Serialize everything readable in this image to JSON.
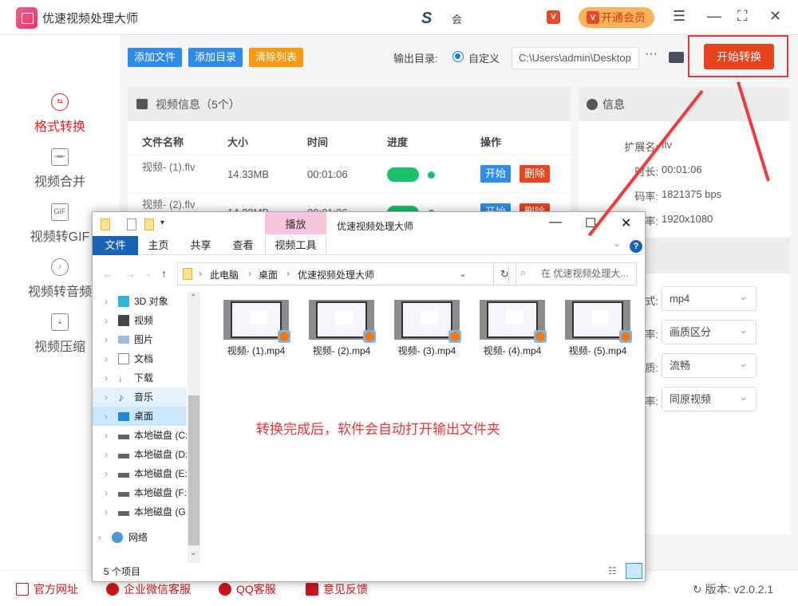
{
  "titlebar": {
    "app_title": "优速视频处理大师",
    "brand_text": "会",
    "vip_badge": "VIP",
    "member_button": "开通会员",
    "menu_icon": "☰",
    "minimize_icon": "—",
    "maximize_icon": "⛶",
    "close_icon": "✕"
  },
  "sidebar": {
    "items": [
      {
        "label": "格式转换",
        "icon": "⇆",
        "active": true
      },
      {
        "label": "视频合并",
        "icon": "⇥⇤"
      },
      {
        "label": "视频转GIF",
        "icon": "GIF"
      },
      {
        "label": "视频转音频",
        "icon": "♪"
      },
      {
        "label": "视频压缩",
        "icon": "⇣"
      }
    ]
  },
  "toolbar": {
    "add_file": "添加文件",
    "add_dir": "添加目录",
    "clear_list": "清除列表",
    "output_label": "输出目录:",
    "custom_option": "自定义",
    "output_path": "C:\\Users\\admin\\Desktop",
    "more": "···",
    "start_convert": "开始转换"
  },
  "video_panel": {
    "title": "视频信息（5个）",
    "columns": [
      "文件名称",
      "大小",
      "时间",
      "进度",
      "操作"
    ],
    "rows": [
      {
        "name": "视频- (1).flv",
        "size": "14.33MB",
        "time": "00:01:06",
        "progress": 100,
        "start": "开始",
        "delete": "删除"
      },
      {
        "name": "视频- (2).flv",
        "size": "14.33MB",
        "time": "00:01:06",
        "progress": 100,
        "start": "开始",
        "delete": "删除"
      }
    ]
  },
  "info_panel": {
    "title": "信息",
    "rows": [
      {
        "key": "扩展名:",
        "value": "flv"
      },
      {
        "key": "时长:",
        "value": "00:01:06"
      },
      {
        "key": "码率:",
        "value": "1821375 bps"
      },
      {
        "key": "分辨率:",
        "value": "1920x1080"
      }
    ],
    "settings": [
      {
        "key": "格式:",
        "value": "mp4"
      },
      {
        "key": "分辨率:",
        "value": "画质区分"
      },
      {
        "key": "画质:",
        "value": "流畅"
      },
      {
        "key": "帧率:",
        "value": "同原视频"
      }
    ]
  },
  "footer": {
    "links": [
      "官方网址",
      "企业微信客服",
      "QQ客服",
      "意见反馈"
    ],
    "version": "版本: v2.0.2.1"
  },
  "explorer": {
    "context_tab": "播放",
    "window_title": "优速视频处理大师",
    "ribbon_tabs": [
      "文件",
      "主页",
      "共享",
      "查看",
      "视频工具"
    ],
    "breadcrumb": [
      "此电脑",
      "桌面",
      "优速视频处理大师"
    ],
    "search_placeholder": "在 优速视频处理大...",
    "tree": [
      "3D 对象",
      "视频",
      "图片",
      "文档",
      "下载",
      "音乐",
      "桌面",
      "本地磁盘 (C:",
      "本地磁盘 (D:",
      "本地磁盘 (E:",
      "本地磁盘 (F:",
      "本地磁盘 (G:",
      "网络"
    ],
    "files": [
      "视频- (1).mp4",
      "视频- (2).mp4",
      "视频- (3).mp4",
      "视频- (4).mp4",
      "视频- (5).mp4"
    ],
    "status": "5 个项目"
  },
  "annotation": "转换完成后，软件会自动打开输出文件夹"
}
